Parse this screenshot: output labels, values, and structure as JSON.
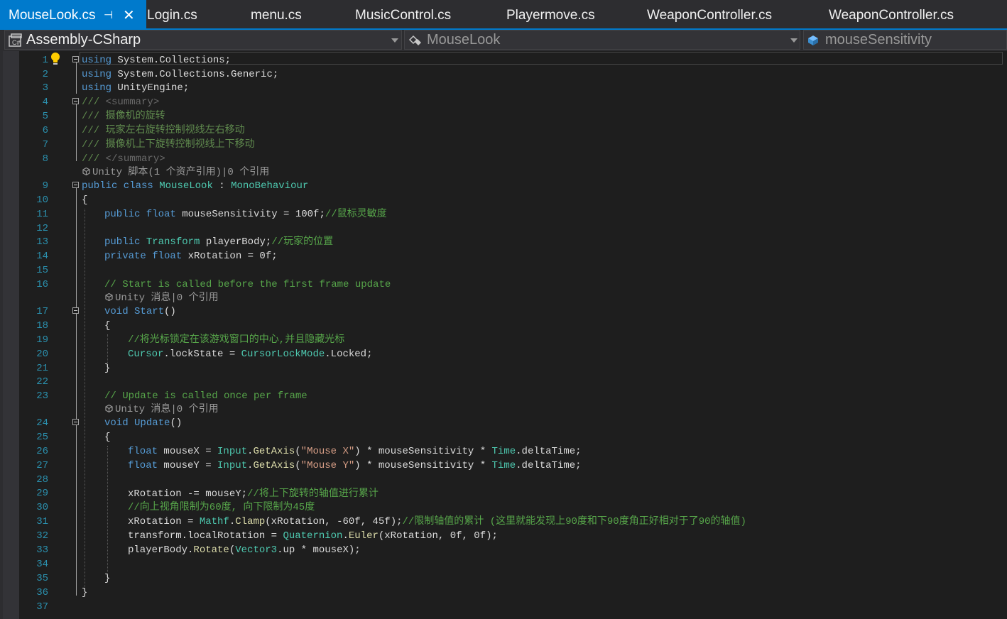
{
  "tabs": [
    {
      "label": "MouseLook.cs",
      "active": true
    },
    {
      "label": "Login.cs",
      "active": false
    },
    {
      "label": "menu.cs",
      "active": false
    },
    {
      "label": "MusicControl.cs",
      "active": false
    },
    {
      "label": "Playermove.cs",
      "active": false
    },
    {
      "label": "WeaponController.cs",
      "active": false
    },
    {
      "label": "WeaponController.cs",
      "active": false
    }
  ],
  "tab_icons": {
    "pin": "⊣",
    "close": "✕"
  },
  "navbar": {
    "project": "Assembly-CSharp",
    "type": "MouseLook",
    "member": "mouseSensitivity"
  },
  "colors": {
    "accent": "#007acc",
    "keyword": "#569cd6",
    "type": "#4ec9b0",
    "comment": "#57a64a",
    "string": "#d69d85",
    "line_number": "#2b91af"
  },
  "editor": {
    "line_numbers": [
      "1",
      "2",
      "3",
      "4",
      "5",
      "6",
      "7",
      "8",
      "9",
      "10",
      "11",
      "12",
      "13",
      "14",
      "15",
      "16",
      "17",
      "18",
      "19",
      "20",
      "21",
      "22",
      "23",
      "24",
      "25",
      "26",
      "27",
      "28",
      "29",
      "30",
      "31",
      "32",
      "33",
      "34",
      "35",
      "36",
      "37"
    ],
    "codelens": {
      "class_refs": "Unity 脚本(1 个资产引用)|0 个引用",
      "start_refs": "Unity 消息|0 个引用",
      "update_refs": "Unity 消息|0 个引用"
    },
    "code": {
      "l1_kw": "using",
      "l1_rest": " System.Collections;",
      "l2_kw": "using",
      "l2_rest": " System.Collections.Generic;",
      "l3_kw": "using",
      "l3_rest": " UnityEngine;",
      "l4_a": "/// ",
      "l4_b": "<summary>",
      "l5": "/// 摄像机的旋转",
      "l6": "/// 玩家左右旋转控制视线左右移动",
      "l7": "/// 摄像机上下旋转控制视线上下移动",
      "l8_a": "/// ",
      "l8_b": "</summary>",
      "l9_kw": "public class",
      "l9_sp": " ",
      "l9_name": "MouseLook",
      "l9_colon": " : ",
      "l9_base": "MonoBehaviour",
      "l10": "{",
      "l11_kw": "public float",
      "l11_rest": " mouseSensitivity = 100f;",
      "l11_cm": "//鼠标灵敏度",
      "l13_kw": "public",
      "l13_sp": " ",
      "l13_ty": "Transform",
      "l13_rest": " playerBody;",
      "l13_cm": "//玩家的位置",
      "l14_kw": "private float",
      "l14_rest": " xRotation = 0f;",
      "l16_cm": "// Start is called before the first frame update",
      "l17_kw": "void",
      "l17_sp": " ",
      "l17_name": "Start",
      "l17_rest": "()",
      "l18": "{",
      "l19_cm": "//将光标锁定在该游戏窗口的中心,并且隐藏光标",
      "l20_ty": "Cursor",
      "l20_a": ".lockState = ",
      "l20_ty2": "CursorLockMode",
      "l20_b": ".Locked;",
      "l21": "}",
      "l23_cm": "// Update is called once per frame",
      "l24_kw": "void",
      "l24_sp": " ",
      "l24_name": "Update",
      "l24_rest": "()",
      "l25": "{",
      "l26_kw": "float",
      "l26_a": " mouseX = ",
      "l26_ty": "Input",
      "l26_b": ".",
      "l26_mt": "GetAxis",
      "l26_c": "(",
      "l26_st": "\"Mouse X\"",
      "l26_d": ") * mouseSensitivity * ",
      "l26_ty2": "Time",
      "l26_e": ".deltaTime;",
      "l27_kw": "float",
      "l27_a": " mouseY = ",
      "l27_ty": "Input",
      "l27_b": ".",
      "l27_mt": "GetAxis",
      "l27_c": "(",
      "l27_st": "\"Mouse Y\"",
      "l27_d": ") * mouseSensitivity * ",
      "l27_ty2": "Time",
      "l27_e": ".deltaTime;",
      "l29_a": "xRotation -= mouseY;",
      "l29_cm": "//将上下旋转的轴值进行累计",
      "l30_cm": "//向上视角限制为60度, 向下限制为45度",
      "l31_a": "xRotation = ",
      "l31_ty": "Mathf",
      "l31_b": ".",
      "l31_mt": "Clamp",
      "l31_c": "(xRotation, -60f, 45f);",
      "l31_cm": "//限制轴值的累计 (这里就能发现上90度和下90度角正好相对于了90的轴值)",
      "l32_a": "transform.localRotation = ",
      "l32_ty": "Quaternion",
      "l32_b": ".",
      "l32_mt": "Euler",
      "l32_c": "(xRotation, 0f, 0f);",
      "l33_a": "playerBody.",
      "l33_mt": "Rotate",
      "l33_b": "(",
      "l33_ty": "Vector3",
      "l33_c": ".up * mouseX);",
      "l35": "}",
      "l36": "}"
    }
  }
}
